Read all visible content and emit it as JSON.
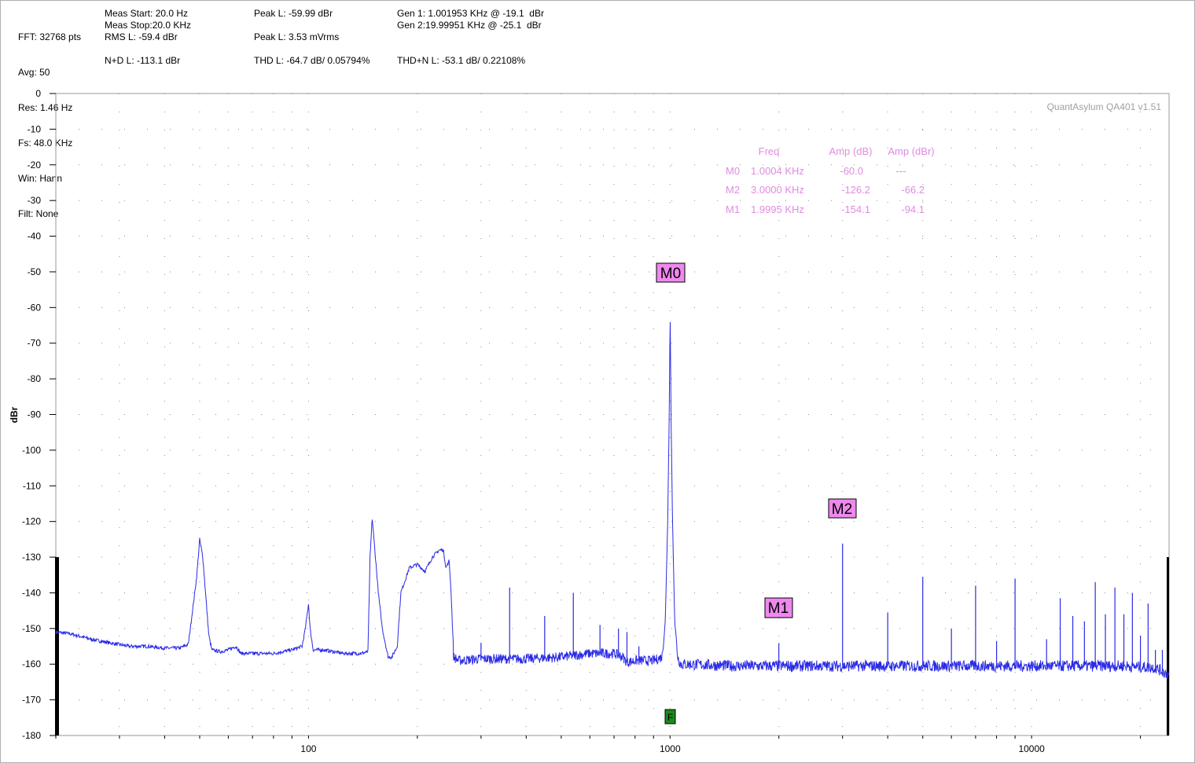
{
  "header": {
    "col1": [
      "FFT: 32768 pts",
      "Avg: 50",
      "Res: 1.46 Hz",
      "Fs: 48.0 KHz",
      "Win: Hann",
      "Filt: None"
    ],
    "meas_start": "Meas Start: 20.0 Hz",
    "meas_stop": "Meas Stop:20.0 KHz",
    "rms_l": "RMS L: -59.4 dBr",
    "nd_l": "N+D L: -113.1 dBr",
    "peak_l_dbr": "Peak L: -59.99 dBr",
    "peak_l_mv": "Peak L: 3.53 mVrms",
    "thd_l": "THD L: -64.7 dB/ 0.05794%",
    "gen1": "Gen 1: 1.001953 KHz @ -19.1  dBr",
    "gen2": "Gen 2:19.99951 KHz @ -25.1  dBr",
    "thdn_l": "THD+N L: -53.1 dB/ 0.22108%"
  },
  "watermark": "QuantAsylum QA401 v1.51",
  "marker_table": {
    "headers": [
      "Freq",
      "Amp (dB)",
      "Amp (dBr)"
    ],
    "rows": [
      {
        "name": "M0",
        "freq": "1.0004 KHz",
        "amp_db": "-60.0",
        "amp_dbr": "---"
      },
      {
        "name": "M2",
        "freq": "3.0000 KHz",
        "amp_db": "-126.2",
        "amp_dbr": "-66.2"
      },
      {
        "name": "M1",
        "freq": "1.9995 KHz",
        "amp_db": "-154.1",
        "amp_dbr": "-94.1"
      }
    ]
  },
  "f_marker_label": "F",
  "colors": {
    "trace": "#2a2ae6",
    "marker_fill": "#ee88ee",
    "marker_table_text": "#e08be0",
    "f_marker": "#1a8a1a"
  },
  "chart_data": {
    "type": "line",
    "ylabel": "dBr",
    "xlabel": "",
    "x_scale": "log",
    "xlim": [
      20,
      24000
    ],
    "ylim": [
      -180,
      0
    ],
    "x_tick_labels": [
      "100",
      "1000",
      "10000"
    ],
    "y_tick_labels": [
      "0",
      "-10",
      "-20",
      "-30",
      "-40",
      "-50",
      "-60",
      "-70",
      "-80",
      "-90",
      "-100",
      "-110",
      "-120",
      "-130",
      "-140",
      "-150",
      "-160",
      "-170",
      "-180"
    ],
    "grid": true,
    "markers": [
      {
        "label": "M0",
        "x": 1000.4,
        "y": -60.0
      },
      {
        "label": "M2",
        "x": 3000,
        "y": -126.2
      },
      {
        "label": "M1",
        "x": 1999.5,
        "y": -154.1
      }
    ],
    "noise_floor_points": [
      [
        20,
        -151
      ],
      [
        22,
        -151.5
      ],
      [
        25,
        -153
      ],
      [
        28,
        -154
      ],
      [
        32,
        -155
      ],
      [
        36,
        -155
      ],
      [
        40,
        -155.5
      ],
      [
        44,
        -155.5
      ],
      [
        46.5,
        -154.5
      ],
      [
        49,
        -136
      ],
      [
        50,
        -125
      ],
      [
        51,
        -130
      ],
      [
        53,
        -152
      ],
      [
        54,
        -156
      ],
      [
        57,
        -156.5
      ],
      [
        60,
        -156
      ],
      [
        63,
        -155
      ],
      [
        65,
        -157
      ],
      [
        70,
        -157
      ],
      [
        80,
        -157
      ],
      [
        90,
        -156
      ],
      [
        96,
        -155
      ],
      [
        98,
        -150
      ],
      [
        100,
        -143
      ],
      [
        101,
        -150
      ],
      [
        103,
        -156
      ],
      [
        110,
        -156
      ],
      [
        125,
        -157
      ],
      [
        140,
        -157
      ],
      [
        146,
        -156.5
      ],
      [
        148,
        -130
      ],
      [
        150,
        -119
      ],
      [
        152,
        -126
      ],
      [
        156,
        -140
      ],
      [
        160,
        -150
      ],
      [
        166,
        -158
      ],
      [
        170,
        -158
      ],
      [
        176,
        -155
      ],
      [
        180,
        -140
      ],
      [
        190,
        -133
      ],
      [
        200,
        -132
      ],
      [
        210,
        -134
      ],
      [
        220,
        -130
      ],
      [
        230,
        -128
      ],
      [
        236,
        -128
      ],
      [
        240,
        -133
      ],
      [
        245,
        -131
      ],
      [
        248,
        -140
      ],
      [
        252,
        -158
      ],
      [
        260,
        -159
      ],
      [
        300,
        -158.5
      ],
      [
        400,
        -158.5
      ],
      [
        500,
        -158
      ],
      [
        600,
        -157
      ],
      [
        700,
        -157
      ],
      [
        740,
        -158
      ],
      [
        760,
        -159.5
      ],
      [
        800,
        -159
      ],
      [
        900,
        -159
      ],
      [
        950,
        -158
      ],
      [
        970,
        -148
      ],
      [
        985,
        -120
      ],
      [
        995,
        -90
      ],
      [
        1000.4,
        -60
      ],
      [
        1006,
        -90
      ],
      [
        1016,
        -120
      ],
      [
        1030,
        -148
      ],
      [
        1050,
        -158
      ],
      [
        1070,
        -160
      ],
      [
        1100,
        -160
      ],
      [
        1500,
        -160.5
      ],
      [
        2000,
        -160.5
      ],
      [
        3000,
        -160.5
      ],
      [
        5000,
        -160.5
      ],
      [
        8000,
        -160.5
      ],
      [
        12000,
        -160.5
      ],
      [
        18000,
        -160.5
      ],
      [
        22000,
        -161
      ],
      [
        24000,
        -163
      ]
    ],
    "spurs": [
      [
        300,
        -154
      ],
      [
        360,
        -138.5
      ],
      [
        450,
        -146.5
      ],
      [
        540,
        -140
      ],
      [
        640,
        -149
      ],
      [
        720,
        -150
      ],
      [
        760,
        -151
      ],
      [
        820,
        -155
      ],
      [
        1999.5,
        -154.1
      ],
      [
        3000,
        -126.2
      ],
      [
        4000,
        -145.5
      ],
      [
        5000,
        -135.5
      ],
      [
        6000,
        -150
      ],
      [
        7000,
        -138
      ],
      [
        8000,
        -153.5
      ],
      [
        9000,
        -136
      ],
      [
        11000,
        -153
      ],
      [
        12000,
        -141.5
      ],
      [
        13000,
        -146.5
      ],
      [
        14000,
        -148
      ],
      [
        15000,
        -137
      ],
      [
        16000,
        -146
      ],
      [
        17000,
        -138.5
      ],
      [
        18000,
        -146
      ],
      [
        19000,
        -140
      ],
      [
        20000,
        -152
      ],
      [
        21000,
        -143
      ],
      [
        22000,
        -156
      ],
      [
        23000,
        -156
      ]
    ]
  }
}
